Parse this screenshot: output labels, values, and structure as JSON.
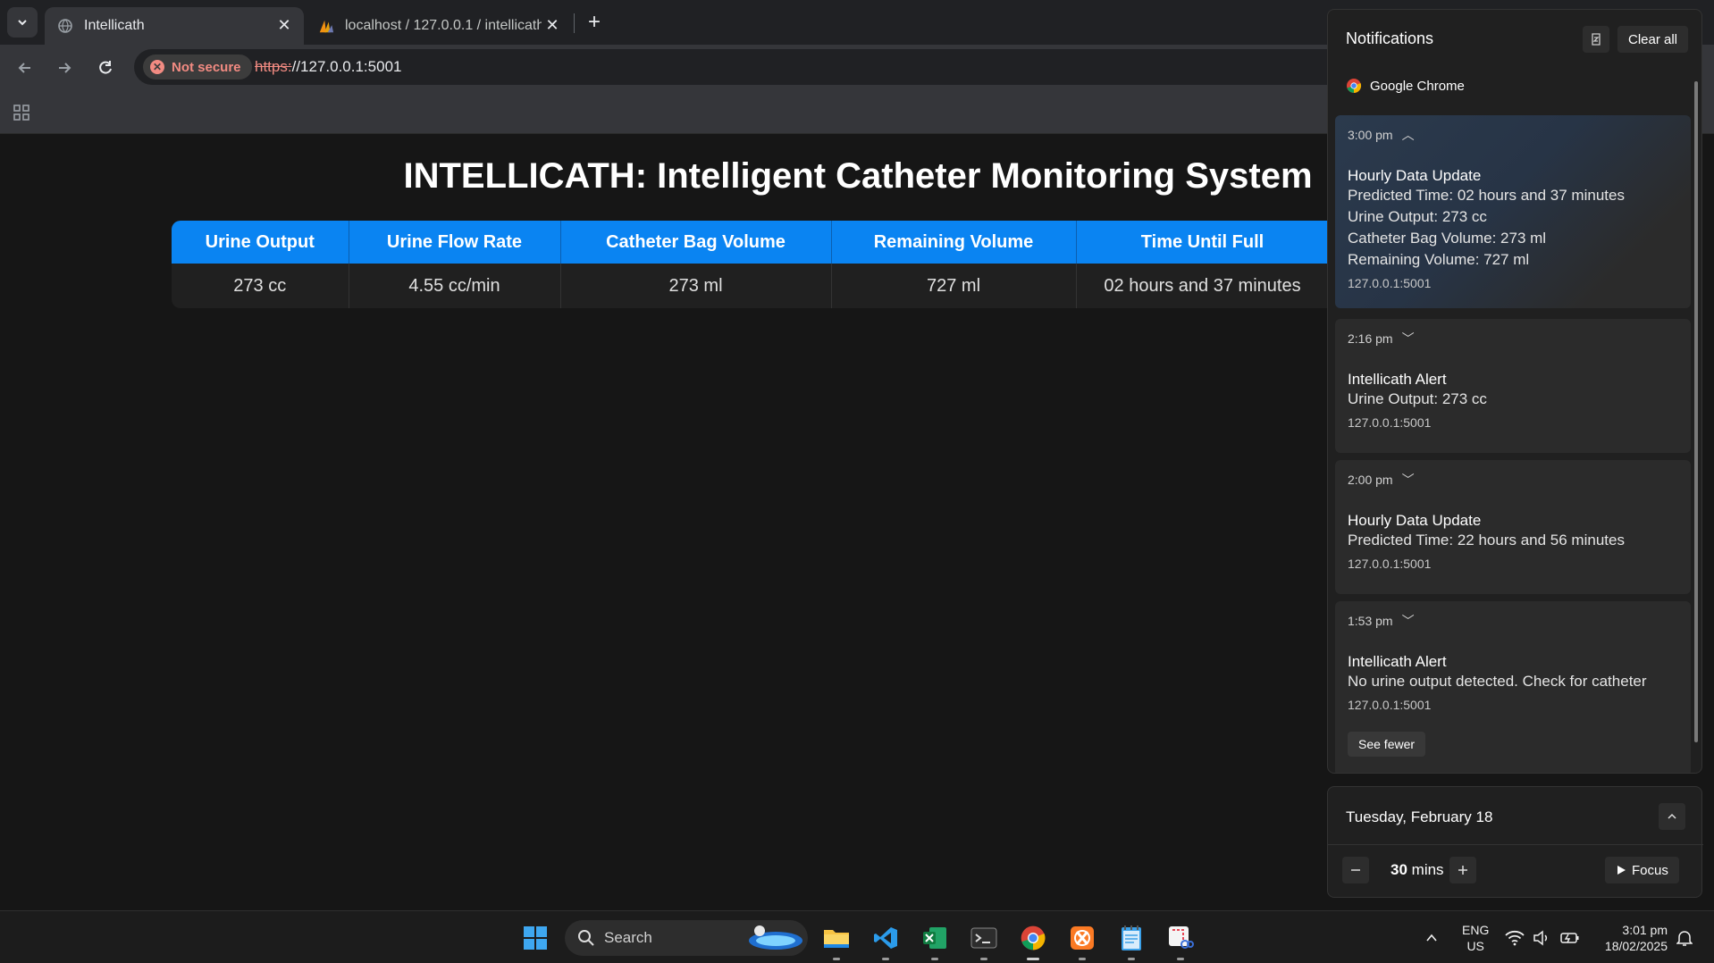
{
  "browser": {
    "tabs": [
      {
        "title": "Intellicath",
        "active": true
      },
      {
        "title": "localhost / 127.0.0.1 / intellicath",
        "active": false
      }
    ],
    "security_label": "Not secure",
    "url_scheme": "https:",
    "url_rest": "//127.0.0.1:5001"
  },
  "page": {
    "title": "INTELLICATH: Intelligent Catheter Monitoring System",
    "table": {
      "headers": [
        "Urine Output",
        "Urine Flow Rate",
        "Catheter Bag Volume",
        "Remaining Volume",
        "Time Until Full"
      ],
      "row": [
        "273 cc",
        "4.55 cc/min",
        "273 ml",
        "727 ml",
        "02 hours and 37 minutes"
      ]
    }
  },
  "notifications": {
    "title": "Notifications",
    "clear_all": "Clear all",
    "app_name": "Google Chrome",
    "items": [
      {
        "time": "3:00 pm",
        "title": "Hourly Data Update",
        "body": "Predicted Time: 02 hours and 37 minutes\n Urine Output: 273 cc\n Catheter Bag Volume: 273 ml\n Remaining Volume: 727 ml",
        "origin": "127.0.0.1:5001"
      },
      {
        "time": "2:16 pm",
        "title": "Intellicath Alert",
        "body": "Urine Output: 273 cc",
        "origin": "127.0.0.1:5001"
      },
      {
        "time": "2:00 pm",
        "title": "Hourly Data Update",
        "body": "Predicted Time: 22 hours and 56 minutes",
        "origin": "127.0.0.1:5001"
      },
      {
        "time": "1:53 pm",
        "title": "Intellicath Alert",
        "body": "No urine output detected. Check for catheter",
        "origin": "127.0.0.1:5001"
      }
    ],
    "see_fewer": "See fewer"
  },
  "calendar": {
    "date": "Tuesday, February 18",
    "focus_minutes": "30",
    "focus_unit": "mins",
    "focus_label": "Focus"
  },
  "taskbar": {
    "search_label": "Search",
    "lang_line1": "ENG",
    "lang_line2": "US",
    "time": "3:01 pm",
    "date": "18/02/2025"
  },
  "colors": {
    "accent": "#0a84f2",
    "warning": "#f28b82"
  }
}
